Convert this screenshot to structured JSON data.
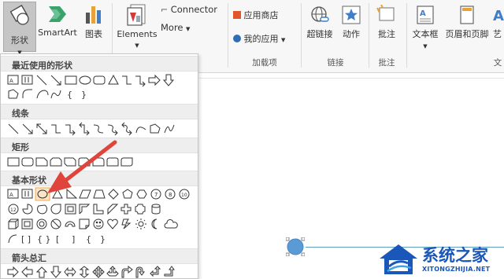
{
  "ribbon": {
    "shapes_label": "形状",
    "smartart_label": "SmartArt",
    "chart_label": "图表",
    "elements_label": "Elements",
    "connector_label": "Connector",
    "more_label": "More",
    "app_store_label": "应用商店",
    "my_apps_label": "我的应用",
    "addins_group": "加载项",
    "hyperlink_label": "超链接",
    "action_label": "动作",
    "links_group": "链接",
    "comment_label": "批注",
    "comments_group": "批注",
    "textbox_label": "文本框",
    "header_footer_label": "页眉和页脚",
    "art_label": "艺",
    "text_group": "文"
  },
  "dropdown": {
    "recent_header": "最近使用的形状",
    "lines_header": "线条",
    "rect_header": "矩形",
    "basic_header": "基本形状",
    "arrows_header": "箭头总汇"
  },
  "watermark": {
    "brand": "系统之家",
    "url": "XITONGZHIJIA.NET"
  },
  "colors": {
    "accent_red": "#e0443a",
    "shape_blue": "#5b9bd5",
    "watermark_blue": "#1a57b8"
  }
}
